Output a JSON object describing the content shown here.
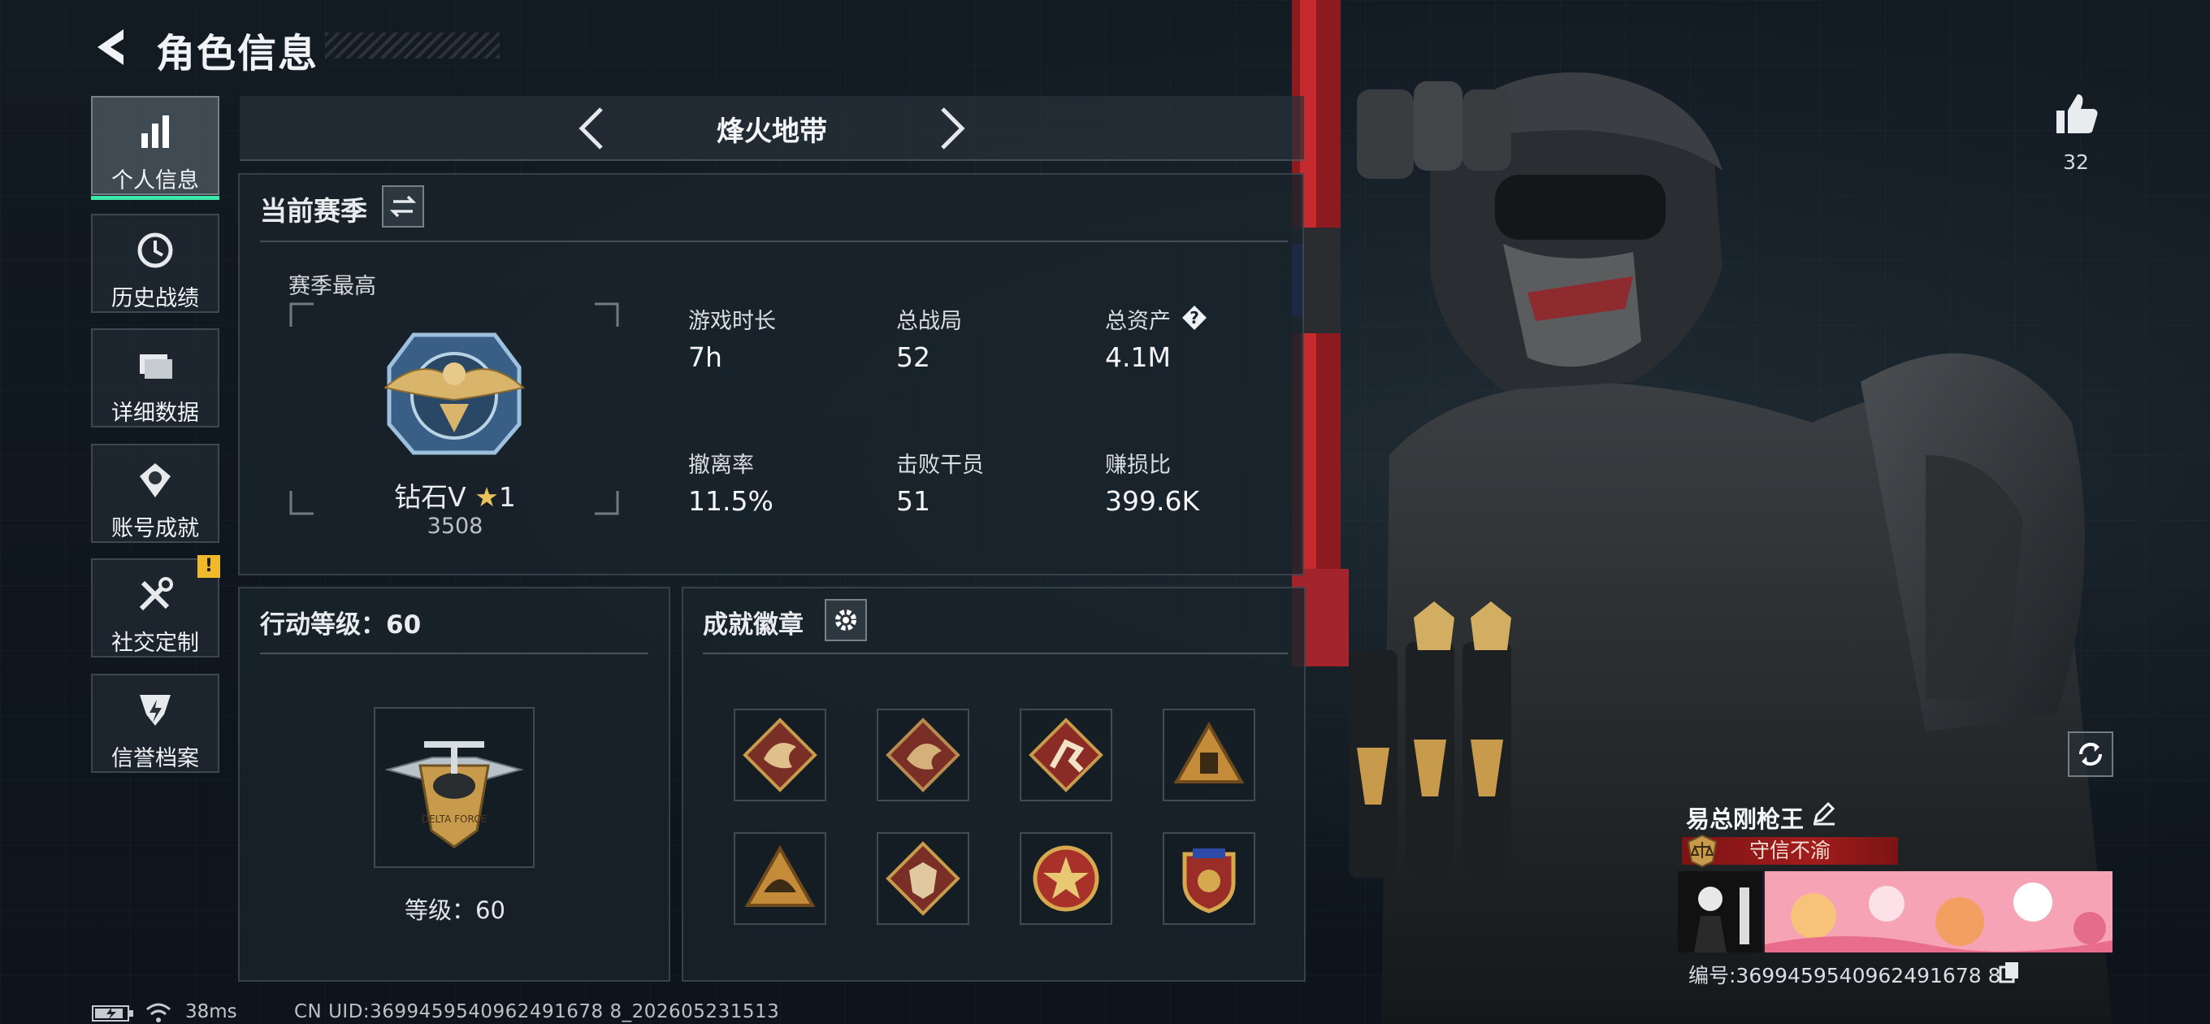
{
  "header": {
    "title": "角色信息"
  },
  "nav": {
    "items": [
      {
        "label": "个人信息",
        "active": true
      },
      {
        "label": "历史战绩"
      },
      {
        "label": "详细数据"
      },
      {
        "label": "账号成就"
      },
      {
        "label": "社交定制",
        "badge": "!"
      },
      {
        "label": "信誉档案"
      }
    ]
  },
  "mode": {
    "title": "烽火地带"
  },
  "season": {
    "title": "当前赛季",
    "best_label": "赛季最高",
    "rank_name": "钻石V",
    "rank_star": "1",
    "rank_score": "3508",
    "stats": [
      {
        "label": "游戏时长",
        "value": "7h"
      },
      {
        "label": "总战局",
        "value": "52"
      },
      {
        "label": "总资产",
        "value": "4.1M",
        "help": "?"
      },
      {
        "label": "撤离率",
        "value": "11.5%"
      },
      {
        "label": "击败干员",
        "value": "51"
      },
      {
        "label": "赚损比",
        "value": "399.6K"
      }
    ]
  },
  "level": {
    "title": "行动等级：60",
    "level_text": "等级：60",
    "badge_text": "DELTA FORCE"
  },
  "badges": {
    "title": "成就徽章",
    "count": 8
  },
  "likes": {
    "count": "32"
  },
  "player": {
    "name": "易总刚枪王",
    "credit": "守信不渝",
    "id_text": "编号:3699459540962491678 8"
  },
  "status": {
    "ping": "38ms",
    "uid": "CN UID:3699459540962491678 8_202605231513"
  },
  "colors": {
    "accent": "#3ee7a8",
    "badge_warning": "#f0b92a",
    "credit_red": "#a31c1c",
    "medal_gold": "#c89a4b"
  }
}
